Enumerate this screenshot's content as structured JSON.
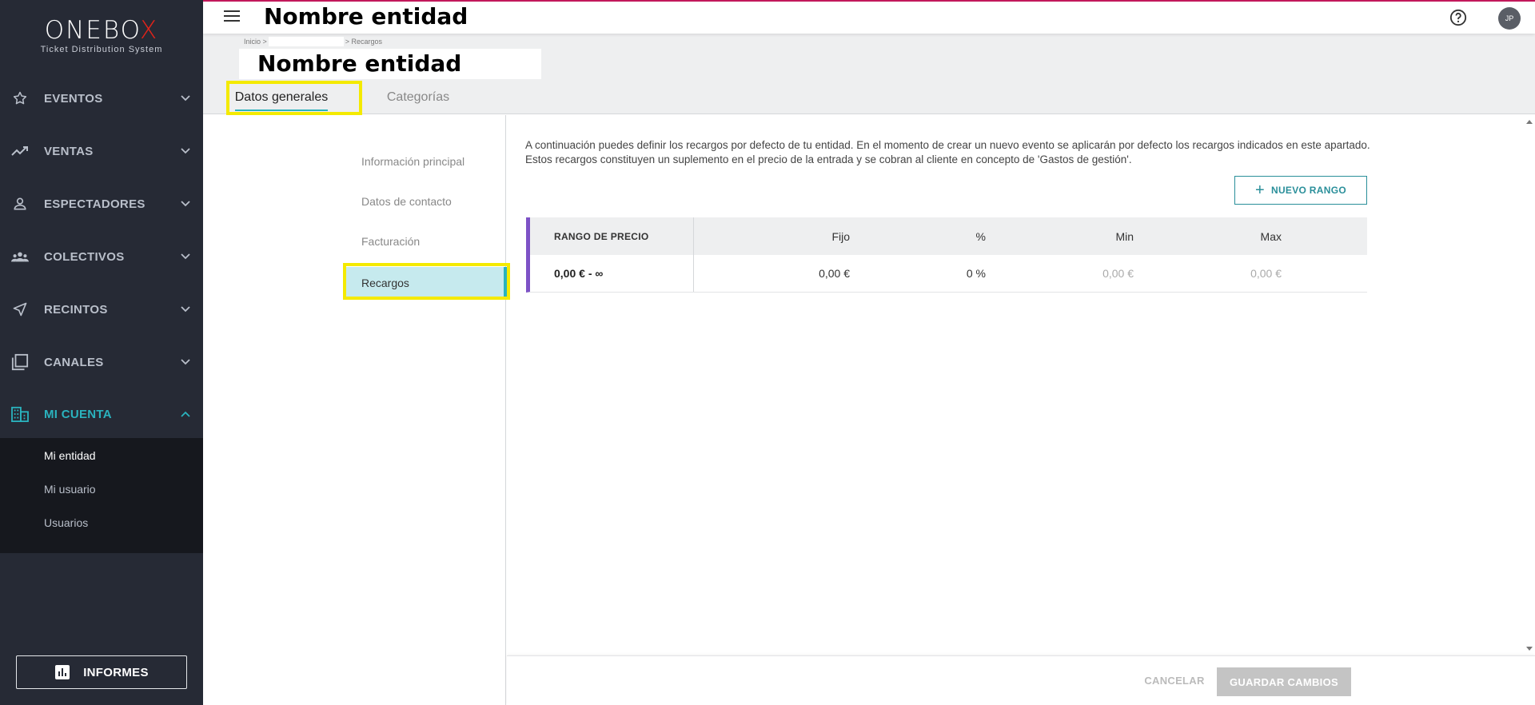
{
  "app": {
    "logo_text_main_a": "ONEBO",
    "logo_text_main_b": "X",
    "logo_subtitle": "Ticket Distribution System"
  },
  "colors": {
    "sidebar_bg": "#262a35",
    "accent": "#2ab3be",
    "table_accent": "#7d52c6",
    "top_border": "#c2185b",
    "highlight": "#f4ea00"
  },
  "sidebar": {
    "items": [
      {
        "label": "EVENTOS",
        "icon": "star-icon"
      },
      {
        "label": "VENTAS",
        "icon": "trending-up-icon"
      },
      {
        "label": "ESPECTADORES",
        "icon": "person-icon"
      },
      {
        "label": "COLECTIVOS",
        "icon": "groups-icon"
      },
      {
        "label": "RECINTOS",
        "icon": "navigation-icon"
      },
      {
        "label": "CANALES",
        "icon": "library-icon"
      },
      {
        "label": "MI CUENTA",
        "icon": "building-icon",
        "active": true
      }
    ],
    "submenu": [
      {
        "label": "Mi entidad",
        "active": true
      },
      {
        "label": "Mi usuario"
      },
      {
        "label": "Usuarios"
      }
    ],
    "informes_label": "INFORMES"
  },
  "topbar": {
    "title": "Nombre entidad",
    "avatar_initials": "JP"
  },
  "header": {
    "breadcrumb_start": "Inicio >",
    "breadcrumb_end": "> Recargos",
    "title": "Nombre entidad",
    "tabs": [
      {
        "label": "Datos generales",
        "active": true
      },
      {
        "label": "Categorías"
      }
    ]
  },
  "secondary_nav": {
    "items": [
      {
        "label": "Información principal"
      },
      {
        "label": "Datos de contacto"
      },
      {
        "label": "Facturación"
      },
      {
        "label": "Recargos",
        "active": true
      }
    ]
  },
  "main": {
    "description": "A continuación puedes definir los recargos por defecto de tu entidad. En el momento de crear un nuevo evento se aplicarán por defecto los recargos indicados en este apartado. Estos recargos constituyen un suplemento en el precio de la entrada y se cobran al cliente en concepto de 'Gastos de gestión'.",
    "new_range_label": "NUEVO RANGO",
    "table": {
      "headers": {
        "range": "RANGO DE PRECIO",
        "fijo": "Fijo",
        "pct": "%",
        "min": "Min",
        "max": "Max"
      },
      "rows": [
        {
          "range": "0,00 € - ∞",
          "fijo": "0,00 €",
          "pct": "0 %",
          "min": "0,00 €",
          "max": "0,00 €"
        }
      ]
    }
  },
  "footer": {
    "cancel_label": "CANCELAR",
    "save_label": "GUARDAR CAMBIOS"
  }
}
